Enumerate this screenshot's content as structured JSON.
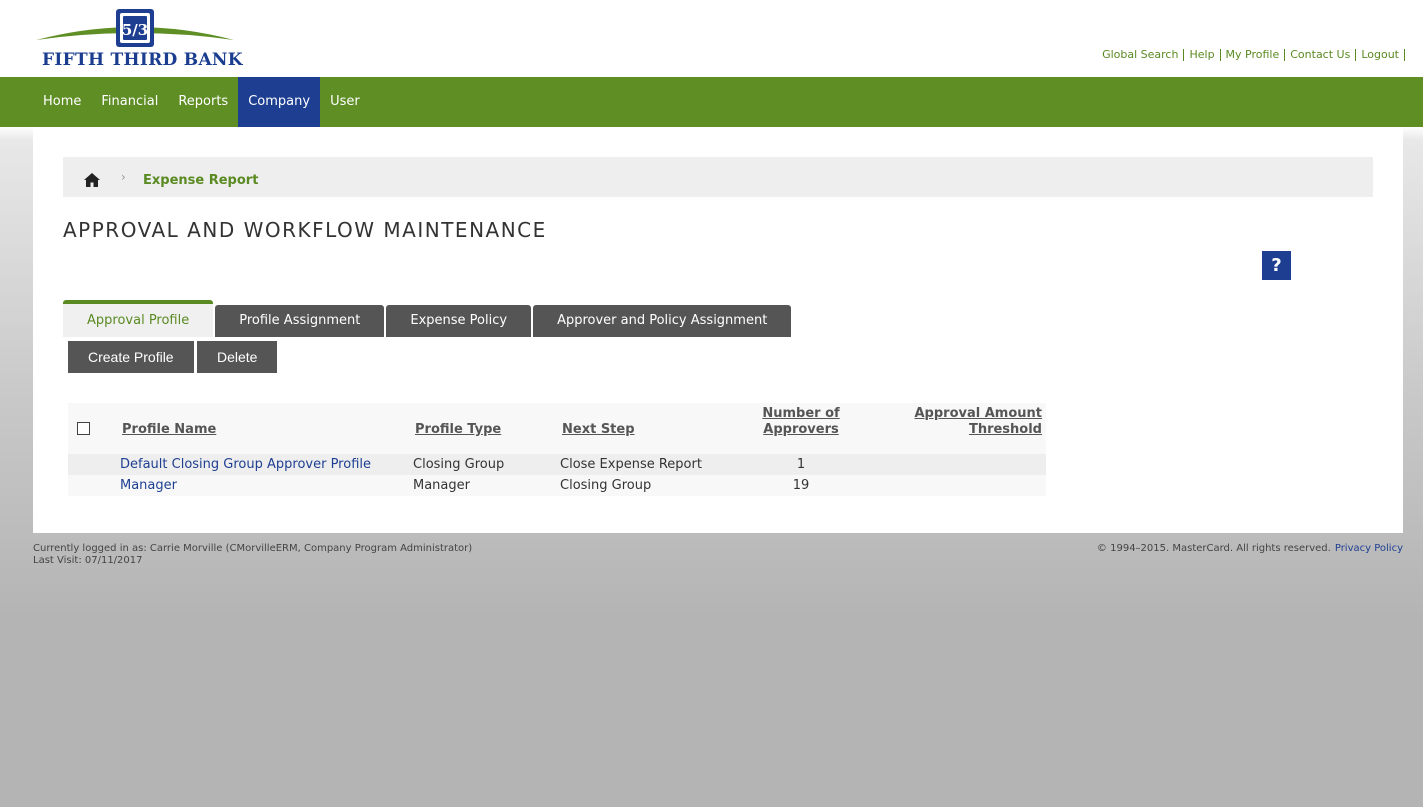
{
  "brand": {
    "name": "FIFTH THIRD BANK",
    "logo_mark": "5/3",
    "green": "#5e8e24",
    "blue": "#1e3f91"
  },
  "top_links": [
    "Global Search",
    "Help",
    "My Profile",
    "Contact Us",
    "Logout"
  ],
  "nav": {
    "items": [
      "Home",
      "Financial",
      "Reports",
      "Company",
      "User"
    ],
    "active": "Company"
  },
  "breadcrumb": {
    "home_icon": "home-icon",
    "separator": "›",
    "current": "Expense Report"
  },
  "page_title": "APPROVAL AND WORKFLOW MAINTENANCE",
  "help_label": "?",
  "tabs": [
    {
      "label": "Approval Profile",
      "active": true
    },
    {
      "label": "Profile Assignment",
      "active": false
    },
    {
      "label": "Expense Policy",
      "active": false
    },
    {
      "label": "Approver and Policy Assignment",
      "active": false
    }
  ],
  "actions": {
    "create_label": "Create Profile",
    "delete_label": "Delete"
  },
  "table": {
    "headers": {
      "profile_name": "Profile Name",
      "profile_type": "Profile Type",
      "next_step": "Next Step",
      "approvers_line1": "Number of",
      "approvers_line2": "Approvers",
      "threshold_line1": "Approval Amount",
      "threshold_line2": "Threshold"
    },
    "rows": [
      {
        "name": "Default Closing Group Approver Profile",
        "type": "Closing Group",
        "next_step": "Close Expense Report",
        "approvers": "1",
        "threshold": ""
      },
      {
        "name": "Manager",
        "type": "Manager",
        "next_step": "Closing Group",
        "approvers": "19",
        "threshold": ""
      }
    ]
  },
  "footer": {
    "logged_in": "Currently logged in as: Carrie Morville (CMorvilleERM, Company Program Administrator)",
    "last_visit": "Last Visit: 07/11/2017",
    "copyright": "© 1994–2015. MasterCard. All rights reserved.",
    "privacy_label": "Privacy Policy"
  }
}
